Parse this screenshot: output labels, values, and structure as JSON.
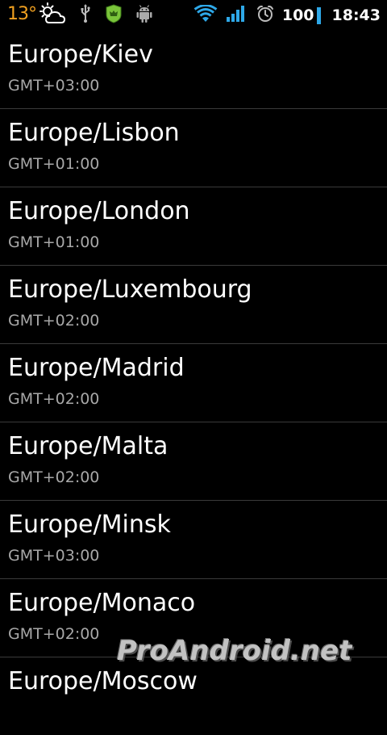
{
  "status_bar": {
    "temperature": "13°",
    "icons_left": [
      "weather-partly-cloudy-icon",
      "usb-icon",
      "app-notification-icon",
      "android-debug-icon"
    ],
    "icons_right": [
      "wifi-icon",
      "signal-strength-icon",
      "alarm-icon"
    ],
    "battery": "100",
    "time": "18:43",
    "colors": {
      "temperature": "#f0a020",
      "wifi": "#2ea8e8",
      "signal": "#2ea8e8",
      "battery_bar": "#2ea8e8",
      "app_icon": "#7ac43a"
    }
  },
  "timezones": [
    {
      "name": "Europe/Kiev",
      "offset": "GMT+03:00"
    },
    {
      "name": "Europe/Lisbon",
      "offset": "GMT+01:00"
    },
    {
      "name": "Europe/London",
      "offset": "GMT+01:00"
    },
    {
      "name": "Europe/Luxembourg",
      "offset": "GMT+02:00"
    },
    {
      "name": "Europe/Madrid",
      "offset": "GMT+02:00"
    },
    {
      "name": "Europe/Malta",
      "offset": "GMT+02:00"
    },
    {
      "name": "Europe/Minsk",
      "offset": "GMT+03:00"
    },
    {
      "name": "Europe/Monaco",
      "offset": "GMT+02:00"
    },
    {
      "name": "Europe/Moscow",
      "offset": ""
    }
  ],
  "watermark": "ProAndroid.net"
}
